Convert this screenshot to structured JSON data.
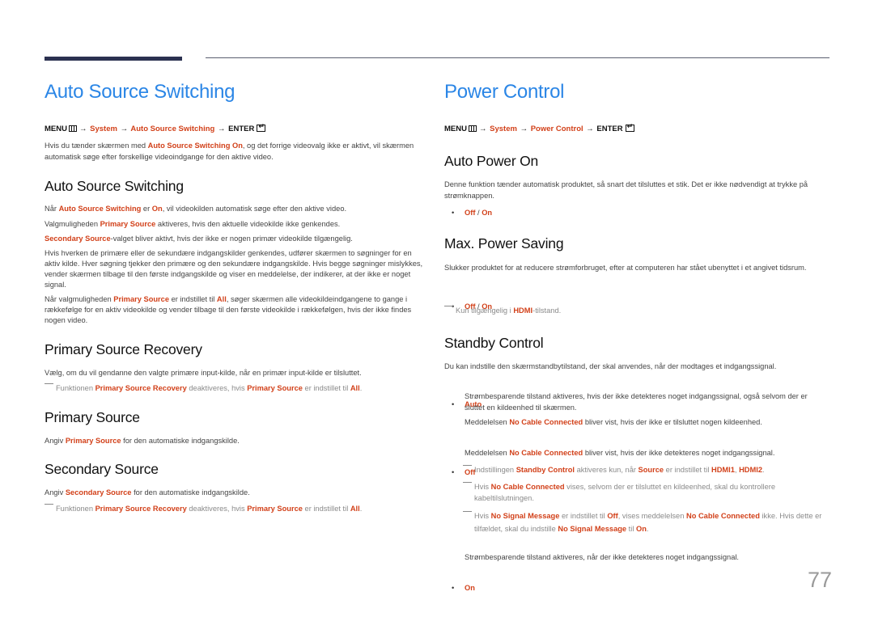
{
  "colors": {
    "title_blue": "#2b86e6",
    "accent": "#d2411a",
    "header_bar": "#2b3150"
  },
  "page_number": "77",
  "left": {
    "title": "Auto Source Switching",
    "menu": {
      "menu": "MENU",
      "icon": "menu-icon",
      "arrow": "→",
      "system": "System",
      "item": "Auto Source Switching",
      "enter": "ENTER",
      "enter_icon": "enter-icon"
    },
    "intro": {
      "t1": "Hvis du tænder skærmen med ",
      "a1": "Auto Source Switching On",
      "t2": ", og det forrige videovalg ikke er aktivt, vil skærmen automatisk søge efter forskellige videoindgange for den aktive video."
    },
    "sections": {
      "auto_source_switching": {
        "heading": "Auto Source Switching",
        "p1": {
          "t1": "Når ",
          "a1": "Auto Source Switching",
          "t2": " er ",
          "a2": "On",
          "t3": ", vil videokilden automatisk søge efter den aktive video."
        },
        "p2": {
          "t1": "Valgmuligheden ",
          "a1": "Primary Source",
          "t2": " aktiveres, hvis den aktuelle videokilde ikke genkendes."
        },
        "p3": {
          "a1": "Secondary Source",
          "t1": "-valget bliver aktivt, hvis der ikke er nogen primær videokilde tilgængelig."
        },
        "p4": "Hvis hverken de primære eller de sekundære indgangskilder genkendes, udfører skærmen to søgninger for en aktiv kilde. Hver søgning tjekker den primære og den sekundære indgangskilde. Hvis begge søgninger mislykkes, vender skærmen tilbage til den første indgangskilde og viser en meddelelse, der indikerer, at der ikke er noget signal.",
        "p5": {
          "t1": "Når valgmuligheden ",
          "a1": "Primary Source",
          "t2": " er indstillet til ",
          "a2": "All",
          "t3": ", søger skærmen alle videokildeindgangene to gange i rækkefølge for en aktiv videokilde og vender tilbage til den første videokilde i rækkefølgen, hvis der ikke findes nogen video."
        }
      },
      "primary_source_recovery": {
        "heading": "Primary Source Recovery",
        "p1": "Vælg, om du vil gendanne den valgte primære input-kilde, når en primær input-kilde er tilsluttet.",
        "note": {
          "t1": "Funktionen ",
          "a1": "Primary Source Recovery",
          "t2": " deaktiveres, hvis ",
          "a2": "Primary Source",
          "t3": " er indstillet til ",
          "a3": "All",
          "t4": "."
        }
      },
      "primary_source": {
        "heading": "Primary Source",
        "p1": {
          "t1": "Angiv ",
          "a1": "Primary Source",
          "t2": " for den automatiske indgangskilde."
        }
      },
      "secondary_source": {
        "heading": "Secondary Source",
        "p1": {
          "t1": "Angiv ",
          "a1": "Secondary Source",
          "t2": " for den automatiske indgangskilde."
        },
        "note": {
          "t1": "Funktionen ",
          "a1": "Primary Source Recovery",
          "t2": " deaktiveres, hvis ",
          "a2": "Primary Source",
          "t3": " er indstillet til ",
          "a3": "All",
          "t4": "."
        }
      }
    }
  },
  "right": {
    "title": "Power Control",
    "menu": {
      "menu": "MENU",
      "arrow": "→",
      "system": "System",
      "item": "Power Control",
      "enter": "ENTER"
    },
    "sections": {
      "auto_power_on": {
        "heading": "Auto Power On",
        "p1": "Denne funktion tænder automatisk produktet, så snart det tilsluttes et stik. Det er ikke nødvendigt at trykke på strømknappen.",
        "options": {
          "off": "Off",
          "sep": " / ",
          "on": "On"
        }
      },
      "max_power_saving": {
        "heading": "Max. Power Saving",
        "p1": "Slukker produktet for at reducere strømforbruget, efter at computeren har stået ubenyttet i et angivet tidsrum.",
        "options": {
          "off": "Off",
          "sep": " / ",
          "on": "On"
        },
        "note": {
          "t1": "Kun tilgængelig i ",
          "a1": "HDMI",
          "t2": "-tilstand."
        }
      },
      "standby_control": {
        "heading": "Standby Control",
        "p1": "Du kan indstille den skærmstandbytilstand, der skal anvendes, når der modtages et indgangssignal.",
        "auto": {
          "label": "Auto",
          "d1": "Strømbesparende tilstand aktiveres, hvis der ikke detekteres noget indgangssignal, også selvom der er sluttet en kildeenhed til skærmen.",
          "d2": {
            "t1": "Meddelelsen ",
            "a1": "No Cable Connected",
            "t2": " bliver vist, hvis der ikke er tilsluttet nogen kildeenhed."
          }
        },
        "off": {
          "label": "Off",
          "d1": {
            "t1": "Meddelelsen ",
            "a1": "No Cable Connected",
            "t2": " bliver vist, hvis der ikke detekteres noget indgangssignal."
          },
          "note1": {
            "t1": "Indstillingen ",
            "a1": "Standby Control",
            "t2": " aktiveres kun, når ",
            "a2": "Source",
            "t3": " er indstillet til ",
            "a3": "HDMI1",
            "t4": ", ",
            "a4": "HDMI2",
            "t5": "."
          },
          "note2": {
            "t1": "Hvis ",
            "a1": "No Cable Connected",
            "t2": " vises, selvom der er tilsluttet en kildeenhed, skal du kontrollere kabeltilslutningen."
          },
          "note3": {
            "t1": "Hvis ",
            "a1": "No Signal Message",
            "t2": " er indstillet til ",
            "a2": "Off",
            "t3": ", vises meddelelsen ",
            "a3": "No Cable Connected",
            "t4": " ikke. Hvis dette er tilfældet, skal du indstille ",
            "a4": "No Signal Message",
            "t5": " til ",
            "a5": "On",
            "t6": "."
          }
        },
        "on": {
          "label": "On",
          "d1": "Strømbesparende tilstand aktiveres, når der ikke detekteres noget indgangssignal."
        }
      }
    }
  }
}
